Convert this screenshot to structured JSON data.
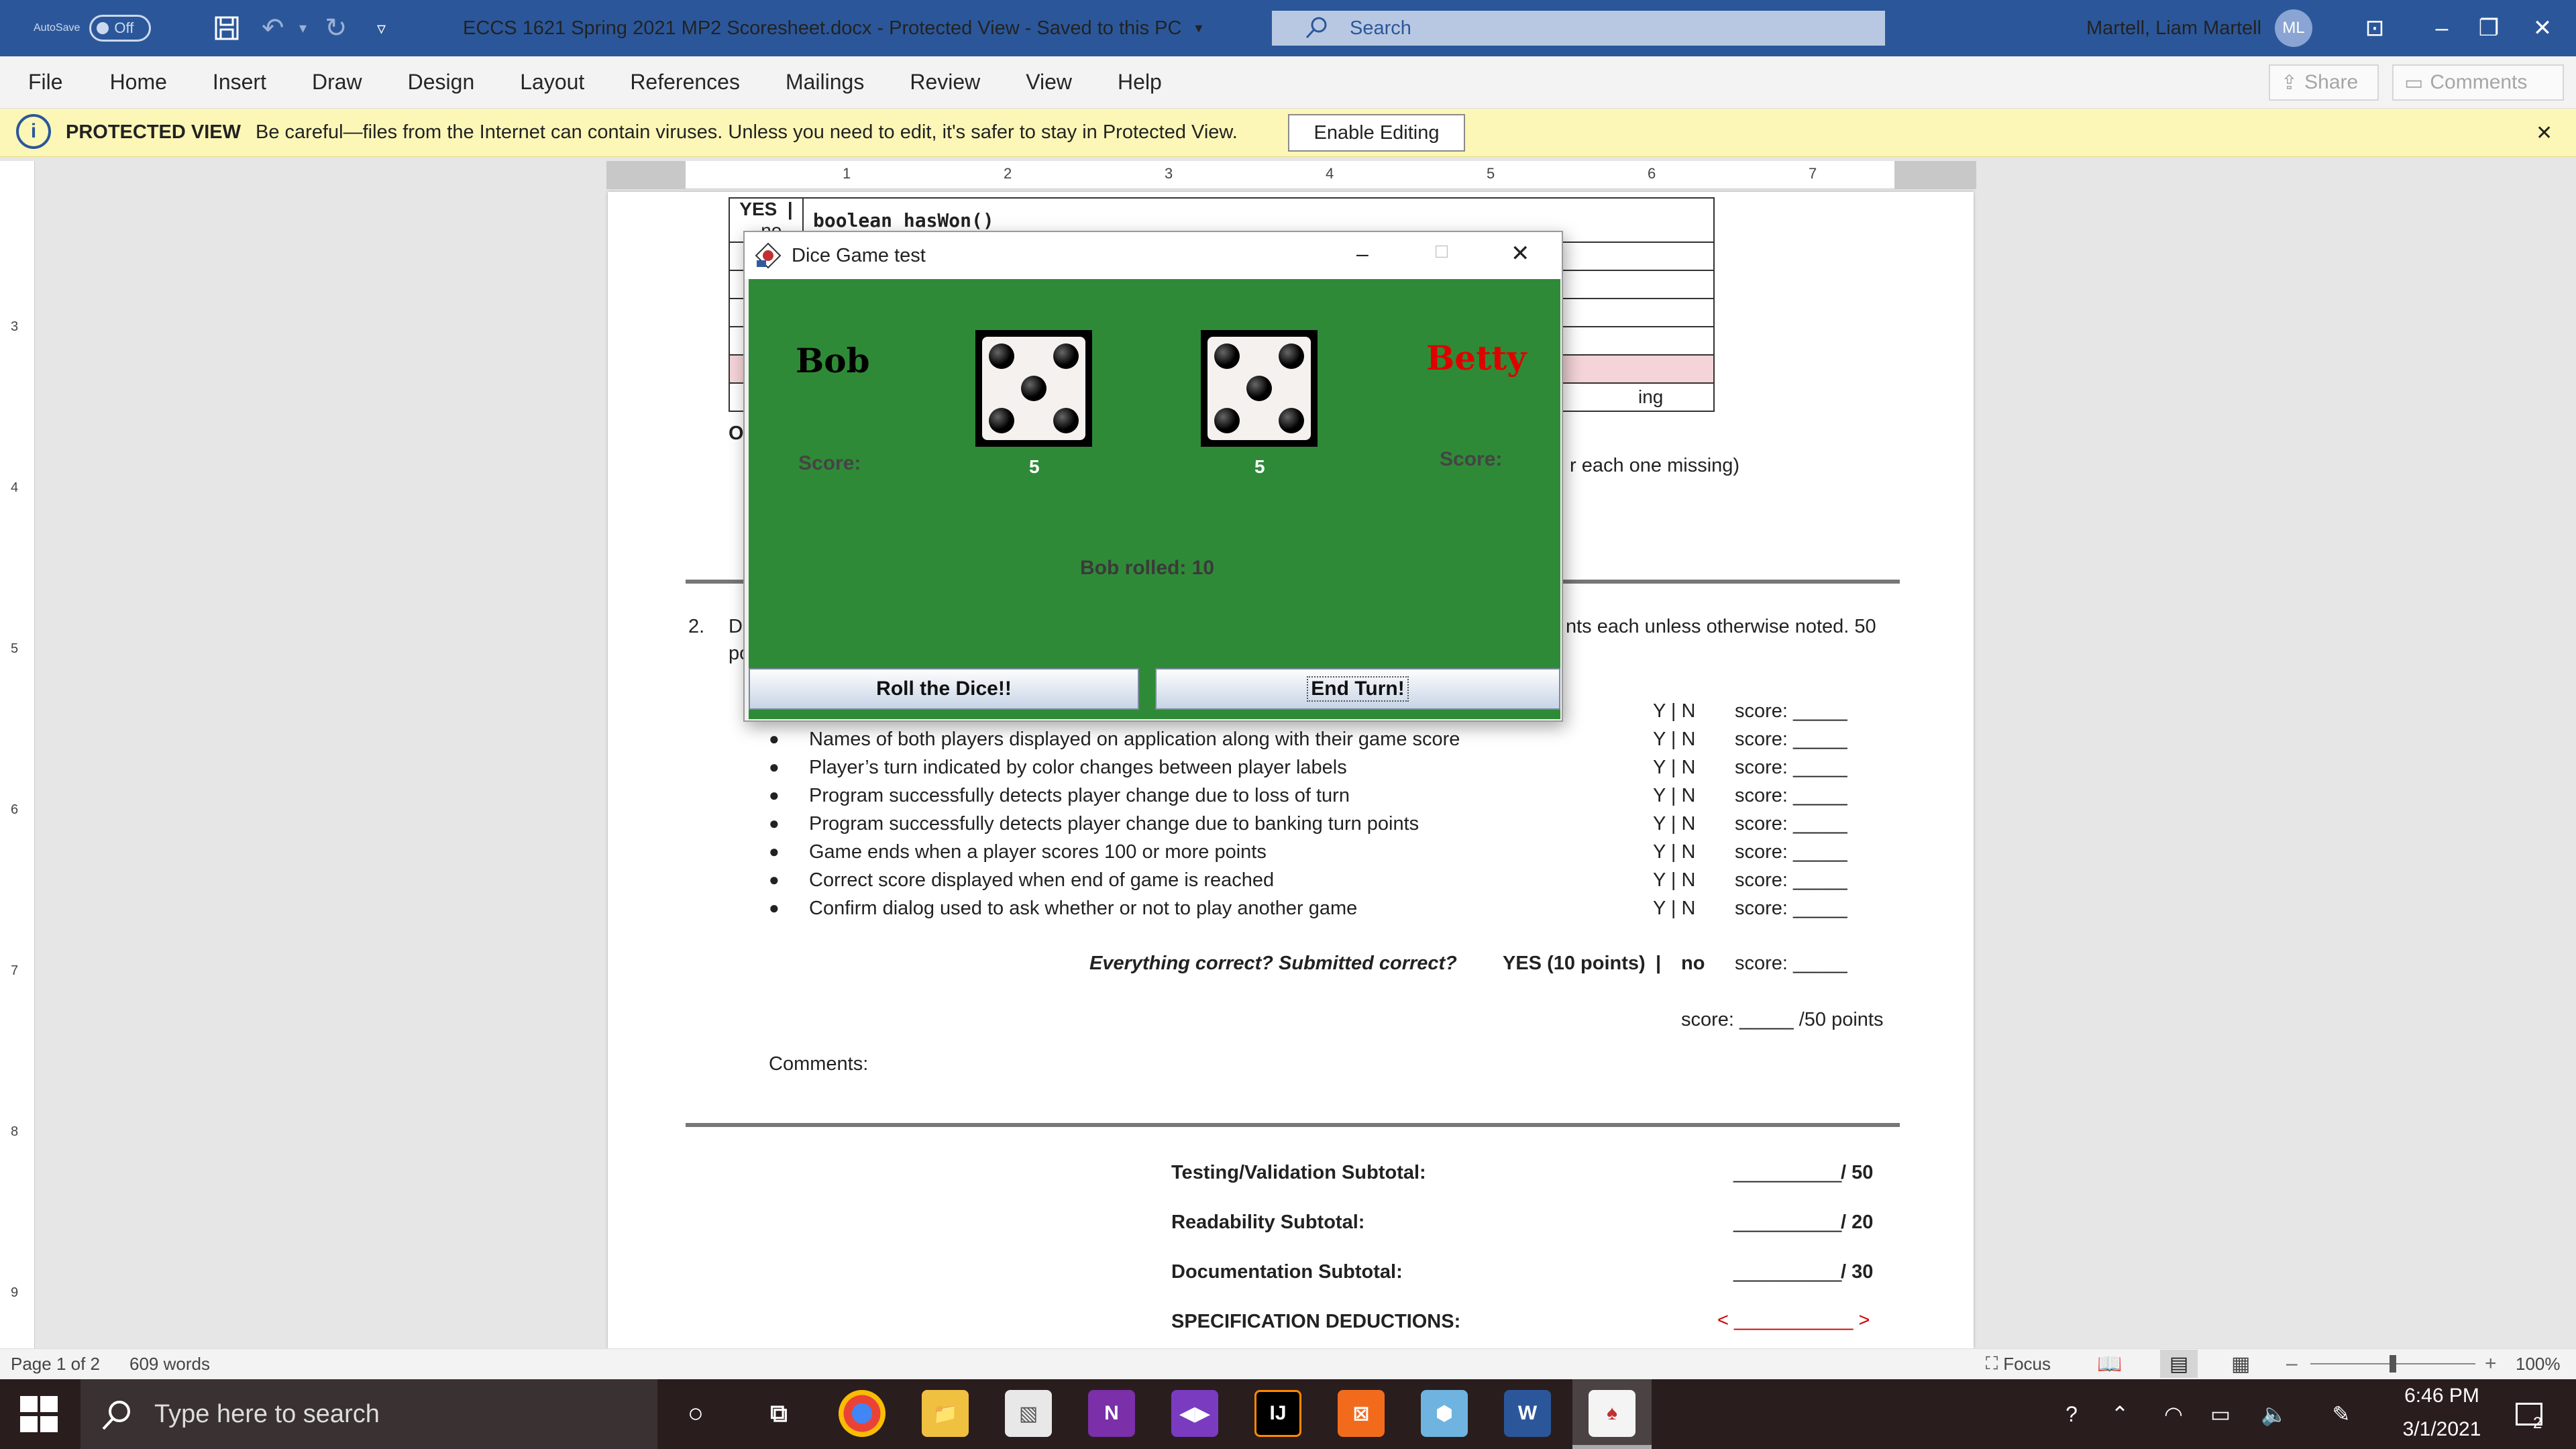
{
  "titlebar": {
    "autosave_label": "AutoSave",
    "autosave_state": "Off",
    "document_title": "ECCS 1621 Spring 2021 MP2 Scoresheet.docx  -  Protected View  -  Saved to this PC",
    "search_placeholder": "Search",
    "user_name": "Martell, Liam Martell",
    "user_initials": "ML",
    "accent": "#2b579a"
  },
  "ribbon": {
    "tabs": [
      "File",
      "Home",
      "Insert",
      "Draw",
      "Design",
      "Layout",
      "References",
      "Mailings",
      "Review",
      "View",
      "Help"
    ],
    "share_label": "Share",
    "comments_label": "Comments"
  },
  "protected_view": {
    "title": "PROTECTED VIEW",
    "message": "Be careful—files from the Internet can contain viruses. Unless you need to edit, it's safer to stay in Protected View.",
    "enable_button": "Enable Editing",
    "background": "#fcf7b6"
  },
  "ruler": {
    "h_numbers": [
      "1",
      "2",
      "3",
      "4",
      "5",
      "6",
      "7"
    ],
    "v_numbers": [
      "3",
      "4",
      "5",
      "6",
      "7",
      "8",
      "9"
    ]
  },
  "document": {
    "table_row1": [
      "YES",
      "|",
      "no",
      "boolean hasWon()"
    ],
    "table_partial_text": "ing",
    "partial_o": "O",
    "partial_missing": "r each one missing)",
    "item2_number": "2.",
    "item2_start": "De",
    "item2_end": "nts each unless otherwise noted. 50",
    "item2_line2": "po",
    "first_yn": "Y | N",
    "first_score": "score: _____",
    "criteria": [
      {
        "text": "Names of both players displayed on application along with their game score",
        "yn": "Y | N",
        "score": "score: _____"
      },
      {
        "text": "Player’s turn indicated by color changes between player labels",
        "yn": "Y | N",
        "score": "score: _____"
      },
      {
        "text": "Program successfully detects player change due to loss of turn",
        "yn": "Y | N",
        "score": "score: _____"
      },
      {
        "text": "Program successfully detects player change due to banking turn points",
        "yn": "Y | N",
        "score": "score: _____"
      },
      {
        "text": "Game ends when a player scores 100 or more points",
        "yn": "Y | N",
        "score": "score: _____"
      },
      {
        "text": "Correct score displayed when end of game is reached",
        "yn": "Y | N",
        "score": "score: _____"
      },
      {
        "text": "Confirm dialog used to ask whether or not to play another game",
        "yn": "Y | N",
        "score": "score: _____"
      }
    ],
    "everything_correct": "Everything correct? Submitted correct?",
    "yes_points": "YES (10 points)",
    "sep": "|",
    "no": "no",
    "everything_score": "score: _____",
    "total_score": "score: _____ /50 points",
    "comments_label": "Comments:",
    "subtotals": [
      {
        "label": "Testing/Validation Subtotal:",
        "blank": "__________",
        "max": "/ 50"
      },
      {
        "label": "Readability Subtotal:",
        "blank": "__________",
        "max": "/ 20"
      },
      {
        "label": "Documentation Subtotal:",
        "blank": "__________",
        "max": "/ 30"
      }
    ],
    "spec_deductions": "SPECIFICATION DEDUCTIONS:",
    "spec_blank": "< ___________ >"
  },
  "dialog": {
    "title": "Dice Game test",
    "player1": "Bob",
    "player2": "Betty",
    "player1_color": "#000000",
    "player2_color": "#e00000",
    "score_label": "Score:",
    "die1_value": "5",
    "die2_value": "5",
    "message": "Bob rolled: 10",
    "roll_button": "Roll the Dice!!",
    "end_button": "End Turn!",
    "background": "#2f8a37"
  },
  "statusbar": {
    "page": "Page 1 of 2",
    "words": "609 words",
    "focus": "Focus",
    "zoom": "100%"
  },
  "taskbar": {
    "search_placeholder": "Type here to search",
    "time": "6:46 PM",
    "date": "3/1/2021",
    "notifications": "2"
  }
}
